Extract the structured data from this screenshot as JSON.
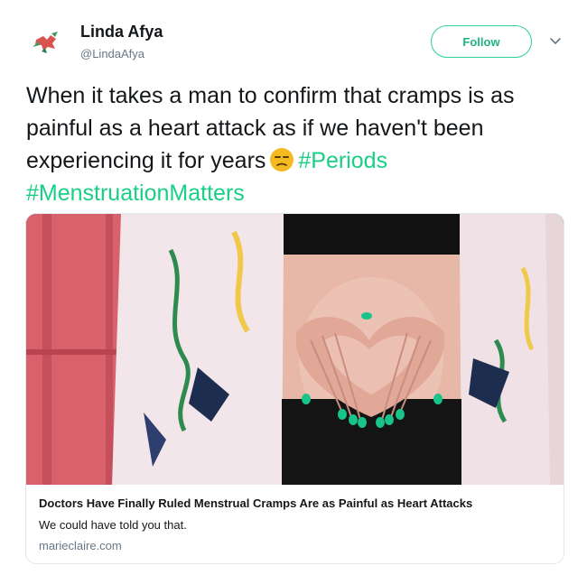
{
  "author": {
    "name": "Linda Afya",
    "handle": "@LindaAfya"
  },
  "header": {
    "follow_label": "Follow"
  },
  "tweet": {
    "text_main": "When it takes a man to confirm that cramps is as painful as a heart attack as if we haven't been experiencing it for years",
    "emoji": "unamused-face-icon",
    "hashtags": [
      "#Periods",
      "#MenstruationMatters"
    ]
  },
  "card": {
    "title": "Doctors Have Finally Ruled Menstrual Cramps Are as Painful as Heart Attacks",
    "description": "We could have told you that.",
    "domain": "marieclaire.com"
  },
  "colors": {
    "accent": "#1da1f2",
    "hashtag": "#19cf86",
    "text": "#14171a",
    "muted": "#657786"
  }
}
